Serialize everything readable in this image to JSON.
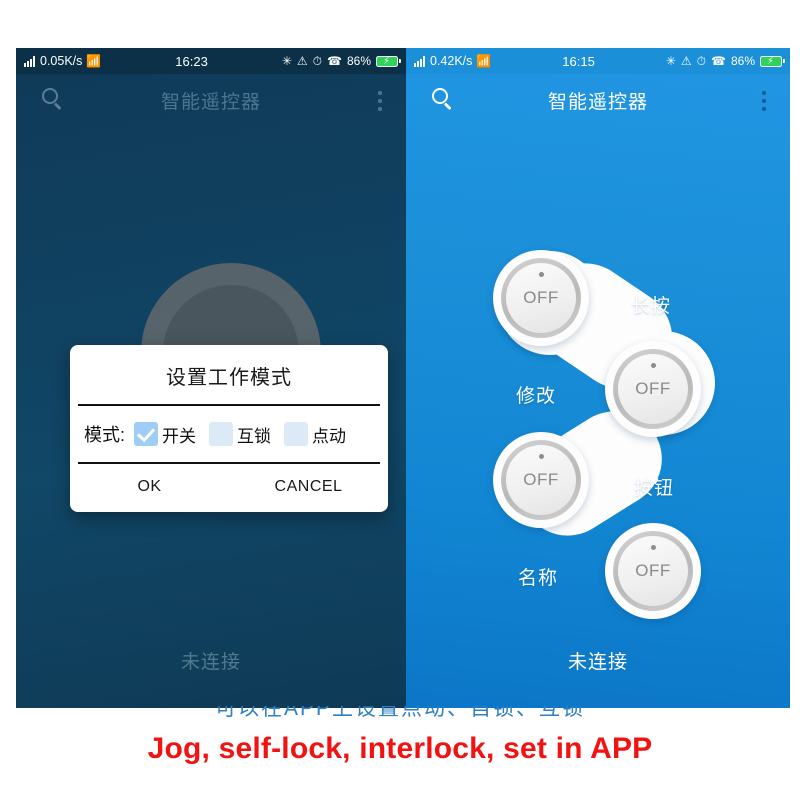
{
  "caption": {
    "text": "Jog, self-lock, interlock, set in APP",
    "color": "#f21212",
    "partial_top_text": "可以在APP上设置点动、自锁、互锁"
  },
  "left_phone": {
    "status_bar": {
      "network_speed": "0.05K/s",
      "time": "16:23",
      "battery_percent": "86%",
      "icons": [
        "signal-icon",
        "wifi-icon",
        "bluetooth-icon",
        "mute-icon",
        "alarm-icon",
        "headset-icon",
        "battery-icon"
      ],
      "bluetooth_glyph": "✳",
      "mute_glyph": "⚠",
      "alarm_glyph": "⏰",
      "headset_glyph": "☎",
      "wifi_glyph": "◠"
    },
    "app_bar": {
      "title": "智能遥控器",
      "search_icon": "search-icon",
      "overflow_icon": "more-vertical-icon"
    },
    "connection_status": "未连接",
    "dialog": {
      "title": "设置工作模式",
      "field_label": "模式:",
      "options": [
        {
          "label": "开关",
          "checked": true
        },
        {
          "label": "互锁",
          "checked": false
        },
        {
          "label": "点动",
          "checked": false
        }
      ],
      "ok_label": "OK",
      "cancel_label": "CANCEL",
      "checked_color": "#9ecdf5",
      "unchecked_color": "#dce9f7"
    },
    "background_color": "#10405f"
  },
  "right_phone": {
    "status_bar": {
      "network_speed": "0.42K/s",
      "time": "16:15",
      "battery_percent": "86%"
    },
    "app_bar": {
      "title": "智能遥控器",
      "search_icon": "search-icon",
      "overflow_icon": "more-vertical-icon"
    },
    "buttons": [
      {
        "state": "OFF"
      },
      {
        "state": "OFF"
      },
      {
        "state": "OFF"
      },
      {
        "state": "OFF"
      }
    ],
    "labels": [
      {
        "text": "长按"
      },
      {
        "text": "修改"
      },
      {
        "text": "按钮"
      },
      {
        "text": "名称"
      }
    ],
    "connection_status": "未连接",
    "background_color": "#1b8fd8"
  }
}
